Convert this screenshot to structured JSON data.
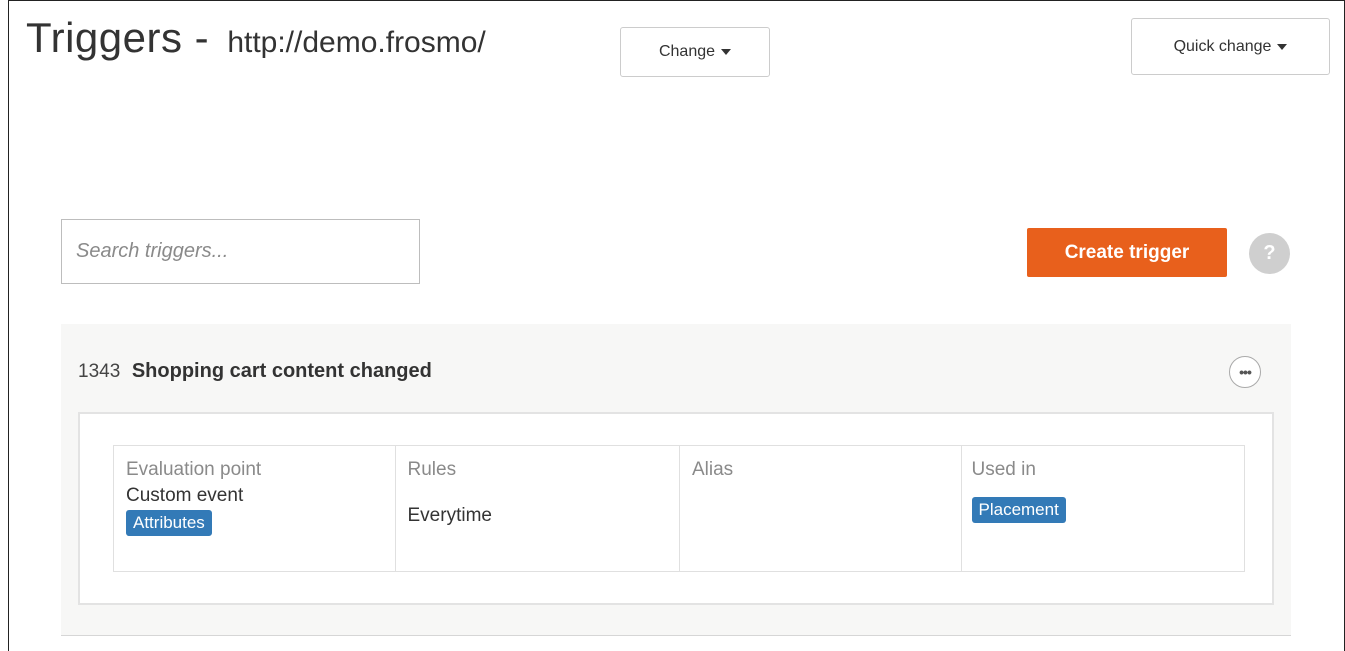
{
  "header": {
    "title": "Triggers - ",
    "site_url": "http://demo.frosmo/",
    "change_label": "Change",
    "quick_change_label": "Quick change"
  },
  "toolbar": {
    "search_placeholder": "Search triggers...",
    "create_label": "Create trigger",
    "help_symbol": "?"
  },
  "trigger": {
    "id": "1343",
    "name": "Shopping cart content changed",
    "more_symbol": "•••",
    "columns": {
      "evaluation_point": {
        "label": "Evaluation point",
        "value": "Custom event",
        "tag": "Attributes"
      },
      "rules": {
        "label": "Rules",
        "value": "Everytime"
      },
      "alias": {
        "label": "Alias",
        "value": ""
      },
      "used_in": {
        "label": "Used in",
        "tag": "Placement"
      }
    }
  },
  "colors": {
    "primary_action": "#e8601c",
    "tag_blue": "#337ab7",
    "card_background": "#f7f7f6"
  }
}
